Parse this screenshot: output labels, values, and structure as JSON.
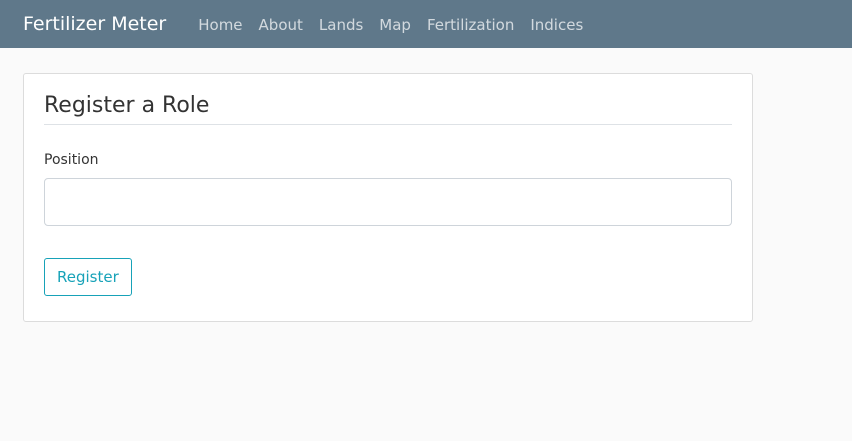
{
  "navbar": {
    "brand": "Fertilizer Meter",
    "links": [
      {
        "label": "Home"
      },
      {
        "label": "About"
      },
      {
        "label": "Lands"
      },
      {
        "label": "Map"
      },
      {
        "label": "Fertilization"
      },
      {
        "label": "Indices"
      }
    ]
  },
  "form": {
    "title": "Register a Role",
    "position_label": "Position",
    "position_value": "",
    "submit_label": "Register"
  },
  "colors": {
    "navbar_bg": "#5f788a",
    "accent": "#17a2b8",
    "page_bg": "#fafafa"
  }
}
